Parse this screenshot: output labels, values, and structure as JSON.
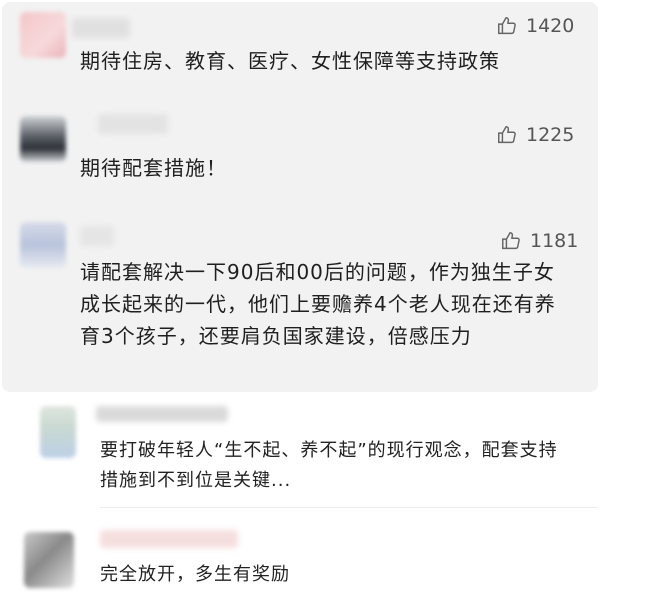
{
  "comments": [
    {
      "likes": "1420",
      "text": "期待住房、教育、医疗、女性保障等支持政策"
    },
    {
      "likes": "1225",
      "text": "期待配套措施！"
    },
    {
      "likes": "1181",
      "text": "请配套解决一下90后和00后的问题，作为独生子女成长起来的一代，他们上要赡养4个老人现在还有养育3个孩子，还要肩负国家建设，倍感压力"
    },
    {
      "text": "要打破年轻人“生不起、养不起”的现行观念，配套支持措施到不到位是关键..."
    },
    {
      "text": "完全放开，多生有奖励"
    }
  ],
  "colors": {
    "panel": "#f2f2f2",
    "text": "#1f1f1f",
    "likes": "#555555"
  },
  "icons": {
    "like": "thumbs-up-icon"
  }
}
